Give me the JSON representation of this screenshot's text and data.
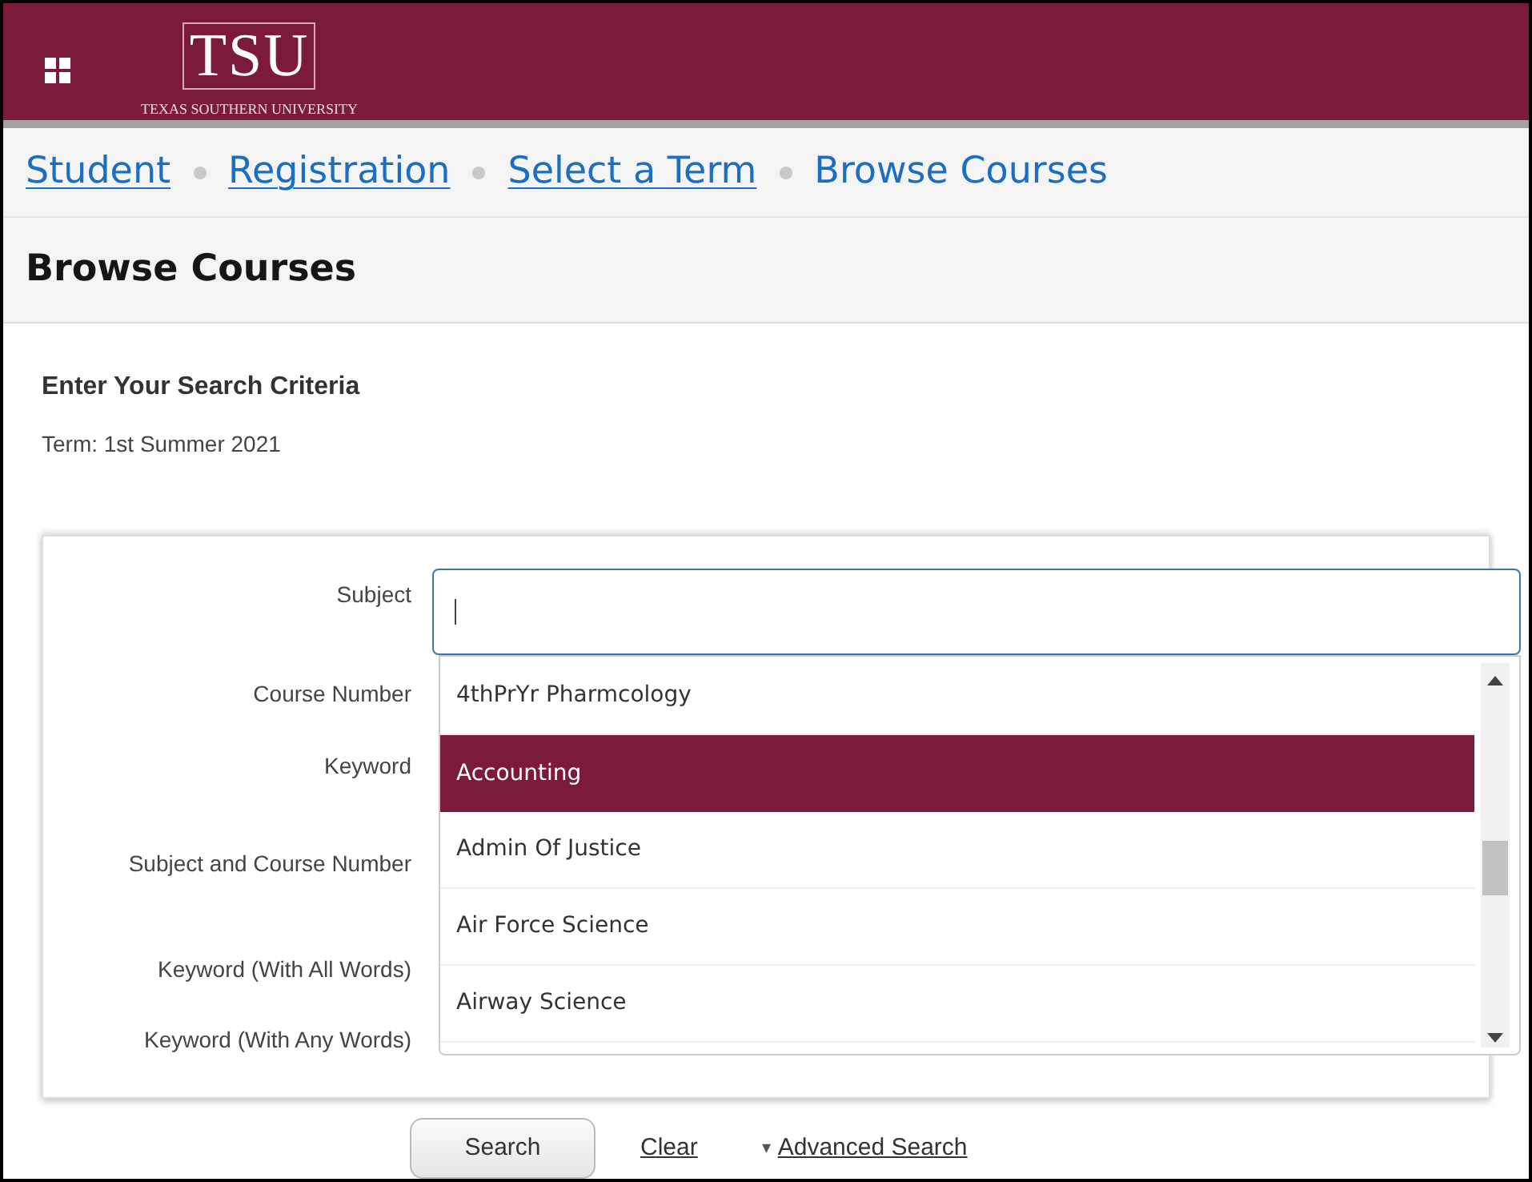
{
  "header": {
    "logo": {
      "mark": "TSU",
      "name": "TEXAS SOUTHERN UNIVERSITY"
    }
  },
  "breadcrumb": [
    {
      "label": "Student",
      "link": true
    },
    {
      "label": "Registration",
      "link": true
    },
    {
      "label": "Select a Term",
      "link": true
    },
    {
      "label": "Browse Courses",
      "link": false
    }
  ],
  "page_title": "Browse Courses",
  "criteria": {
    "heading": "Enter Your Search Criteria",
    "term": "Term: 1st Summer 2021"
  },
  "form": {
    "fields": [
      {
        "label": "Subject"
      },
      {
        "label": "Course Number"
      },
      {
        "label": "Keyword"
      },
      {
        "label": "Subject and Course Number"
      },
      {
        "label": "Keyword (With All Words)"
      },
      {
        "label": "Keyword (With Any Words)"
      }
    ]
  },
  "subject_dropdown": {
    "options": [
      {
        "label": "4thPrYr Pharmcology",
        "selected": false
      },
      {
        "label": "Accounting",
        "selected": true
      },
      {
        "label": "Admin Of Justice",
        "selected": false
      },
      {
        "label": "Air Force Science",
        "selected": false
      },
      {
        "label": "Airway Science",
        "selected": false
      }
    ]
  },
  "actions": {
    "search": "Search",
    "clear": "Clear",
    "advanced": "Advanced Search",
    "advanced_marker": "▾"
  }
}
